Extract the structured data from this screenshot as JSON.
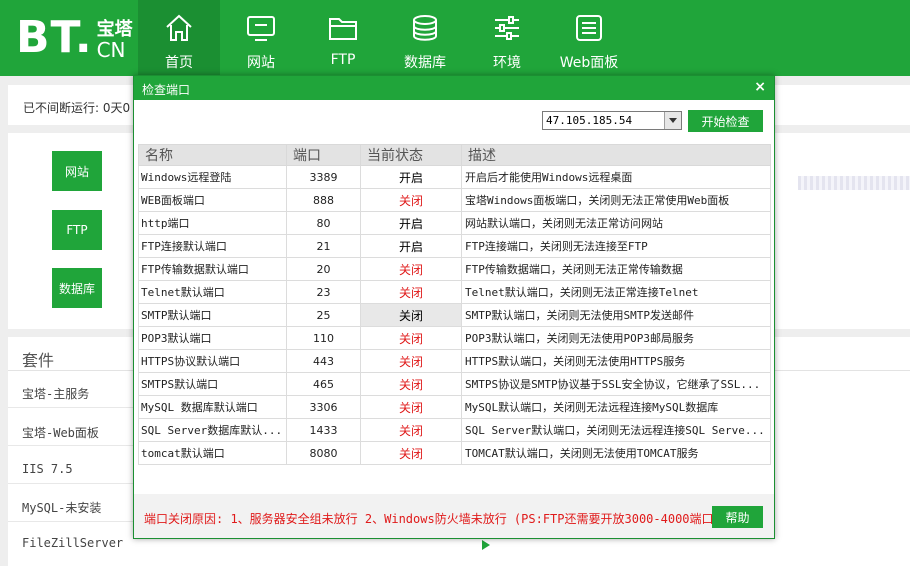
{
  "brand": {
    "logo_main": "BT.",
    "logo_zh": "宝塔",
    "logo_cn": "CN"
  },
  "nav": [
    {
      "label": "首页",
      "icon": "home-icon",
      "active": true
    },
    {
      "label": "网站",
      "icon": "monitor-icon"
    },
    {
      "label": "FTP",
      "icon": "folder-icon"
    },
    {
      "label": "数据库",
      "icon": "database-icon"
    },
    {
      "label": "环境",
      "icon": "sliders-icon"
    },
    {
      "label": "Web面板",
      "icon": "list-icon"
    }
  ],
  "background": {
    "uptime_label": "已不间断运行: 0天0",
    "quick_buttons": [
      "网站",
      "FTP",
      "数据库"
    ],
    "suite_title": "套件",
    "suite_items": [
      "宝塔-主服务",
      "宝塔-Web面板",
      "IIS 7.5",
      "MySQL-未安装",
      "FileZillServer"
    ]
  },
  "dialog": {
    "title": "检查端口",
    "close": "×",
    "ip_value": "47.105.185.54",
    "check_button": "开始检查",
    "headers": {
      "name": "名称",
      "port": "端口",
      "state": "当前状态",
      "desc": "描述"
    },
    "rows": [
      {
        "name": "Windows远程登陆",
        "port": "3389",
        "state": "开启",
        "status": "open",
        "desc": "开启后才能使用Windows远程桌面"
      },
      {
        "name": "WEB面板端口",
        "port": "888",
        "state": "关闭",
        "status": "closed",
        "desc": "宝塔Windows面板端口，关闭则无法正常使用Web面板"
      },
      {
        "name": "http端口",
        "port": "80",
        "state": "开启",
        "status": "open",
        "desc": "网站默认端口，关闭则无法正常访问网站"
      },
      {
        "name": "FTP连接默认端口",
        "port": "21",
        "state": "开启",
        "status": "open",
        "desc": "FTP连接端口，关闭则无法连接至FTP"
      },
      {
        "name": "FTP传输数据默认端口",
        "port": "20",
        "state": "关闭",
        "status": "closed",
        "desc": "FTP传输数据端口，关闭则无法正常传输数据"
      },
      {
        "name": "Telnet默认端口",
        "port": "23",
        "state": "关闭",
        "status": "closed",
        "desc": "Telnet默认端口，关闭则无法正常连接Telnet"
      },
      {
        "name": "SMTP默认端口",
        "port": "25",
        "state": "关闭",
        "status": "selected",
        "desc": "SMTP默认端口，关闭则无法使用SMTP发送邮件"
      },
      {
        "name": "POP3默认端口",
        "port": "110",
        "state": "关闭",
        "status": "closed",
        "desc": "POP3默认端口，关闭则无法使用POP3邮局服务"
      },
      {
        "name": "HTTPS协议默认端口",
        "port": "443",
        "state": "关闭",
        "status": "closed",
        "desc": "HTTPS默认端口，关闭则无法使用HTTPS服务"
      },
      {
        "name": "SMTPS默认端口",
        "port": "465",
        "state": "关闭",
        "status": "closed",
        "desc": "SMTPS协议是SMTP协议基于SSL安全协议，它继承了SSL..."
      },
      {
        "name": "MySQL 数据库默认端口",
        "port": "3306",
        "state": "关闭",
        "status": "closed",
        "desc": "MySQL默认端口，关闭则无法远程连接MySQL数据库"
      },
      {
        "name": "SQL Server数据库默认...",
        "port": "1433",
        "state": "关闭",
        "status": "closed",
        "desc": "SQL Server默认端口，关闭则无法远程连接SQL Serve..."
      },
      {
        "name": "tomcat默认端口",
        "port": "8080",
        "state": "关闭",
        "status": "closed",
        "desc": "TOMCAT默认端口，关闭则无法使用TOMCAT服务"
      }
    ],
    "footer_note": "端口关闭原因: 1、服务器安全组未放行  2、Windows防火墙未放行  (PS:FTP还需要开放3000-4000端口)",
    "help_button": "帮助"
  },
  "colors": {
    "brand_green": "#20a53a",
    "active_nav": "#1b8f32",
    "closed_red": "#e01b1b"
  }
}
